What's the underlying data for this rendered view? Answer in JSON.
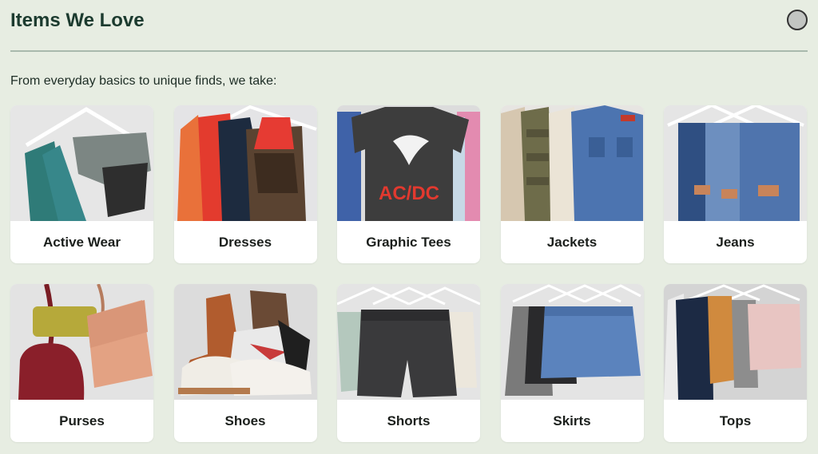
{
  "header": {
    "title": "Items We Love"
  },
  "intro": "From everyday basics to unique finds, we take:",
  "categories": [
    {
      "label": "Active Wear",
      "icon": "active-wear-photo"
    },
    {
      "label": "Dresses",
      "icon": "dresses-photo"
    },
    {
      "label": "Graphic Tees",
      "icon": "graphic-tees-photo",
      "print": "AC/DC"
    },
    {
      "label": "Jackets",
      "icon": "jackets-photo"
    },
    {
      "label": "Jeans",
      "icon": "jeans-photo"
    },
    {
      "label": "Purses",
      "icon": "purses-photo"
    },
    {
      "label": "Shoes",
      "icon": "shoes-photo"
    },
    {
      "label": "Shorts",
      "icon": "shorts-photo"
    },
    {
      "label": "Skirts",
      "icon": "skirts-photo"
    },
    {
      "label": "Tops",
      "icon": "tops-photo"
    }
  ],
  "colors": {
    "background": "#e7ede2",
    "title": "#1c3b2f",
    "card": "#ffffff"
  }
}
